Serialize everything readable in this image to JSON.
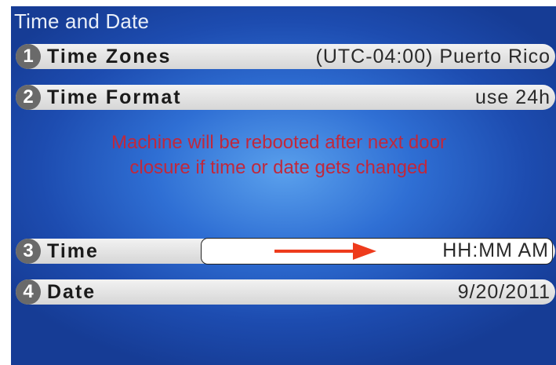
{
  "screen": {
    "title": "Time and Date",
    "warning": "Machine will be rebooted after next door\nclosure if time or date gets changed"
  },
  "rows": [
    {
      "number": "1",
      "label": "Time Zones",
      "value": "(UTC-04:00) Puerto Rico"
    },
    {
      "number": "2",
      "label": "Time Format",
      "value": "use 24h"
    },
    {
      "number": "3",
      "label": "Time",
      "value": "HH:MM AM"
    },
    {
      "number": "4",
      "label": "Date",
      "value": "9/20/2011"
    }
  ],
  "colors": {
    "background_center": "#5aa0ec",
    "background_edge": "#163c95",
    "warning_text": "#c0283c",
    "annotation_arrow": "#ee3b1c"
  },
  "icons": {
    "annotation": "right-arrow-icon"
  }
}
